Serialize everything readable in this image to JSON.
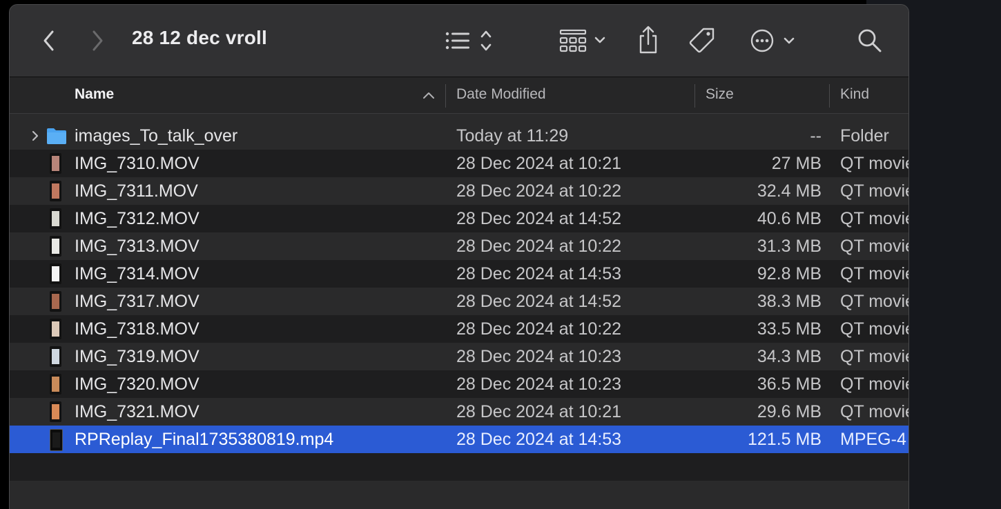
{
  "window": {
    "title": "28 12 dec vroll"
  },
  "toolbar": {
    "back_icon": "chevron-left-icon",
    "forward_icon": "chevron-right-icon",
    "list_view_icon": "list-view-icon",
    "group_icon": "group-grid-icon",
    "share_icon": "share-icon",
    "tag_icon": "tag-icon",
    "more_icon": "ellipsis-circle-icon",
    "search_icon": "search-icon"
  },
  "columns": {
    "name": "Name",
    "date": "Date Modified",
    "size": "Size",
    "kind": "Kind"
  },
  "files": [
    {
      "name": "images_To_talk_over",
      "date": "Today at 11:29",
      "size": "--",
      "kind": "Folder",
      "type": "folder",
      "thumb": "#4aa3f0"
    },
    {
      "name": "IMG_7310.MOV",
      "date": "28 Dec 2024 at 10:21",
      "size": "27 MB",
      "kind": "QT movie",
      "type": "video",
      "thumb": "#b8857a"
    },
    {
      "name": "IMG_7311.MOV",
      "date": "28 Dec 2024 at 10:22",
      "size": "32.4 MB",
      "kind": "QT movie",
      "type": "video",
      "thumb": "#c0785f"
    },
    {
      "name": "IMG_7312.MOV",
      "date": "28 Dec 2024 at 14:52",
      "size": "40.6 MB",
      "kind": "QT movie",
      "type": "video",
      "thumb": "#d9d9d2"
    },
    {
      "name": "IMG_7313.MOV",
      "date": "28 Dec 2024 at 10:22",
      "size": "31.3 MB",
      "kind": "QT movie",
      "type": "video",
      "thumb": "#e9e9e6"
    },
    {
      "name": "IMG_7314.MOV",
      "date": "28 Dec 2024 at 14:53",
      "size": "92.8 MB",
      "kind": "QT movie",
      "type": "video",
      "thumb": "#f4f4f4"
    },
    {
      "name": "IMG_7317.MOV",
      "date": "28 Dec 2024 at 14:52",
      "size": "38.3 MB",
      "kind": "QT movie",
      "type": "video",
      "thumb": "#a8684f"
    },
    {
      "name": "IMG_7318.MOV",
      "date": "28 Dec 2024 at 10:22",
      "size": "33.5 MB",
      "kind": "QT movie",
      "type": "video",
      "thumb": "#dcc9b8"
    },
    {
      "name": "IMG_7319.MOV",
      "date": "28 Dec 2024 at 10:23",
      "size": "34.3 MB",
      "kind": "QT movie",
      "type": "video",
      "thumb": "#cfd7e0"
    },
    {
      "name": "IMG_7320.MOV",
      "date": "28 Dec 2024 at 10:23",
      "size": "36.5 MB",
      "kind": "QT movie",
      "type": "video",
      "thumb": "#c98b5a"
    },
    {
      "name": "IMG_7321.MOV",
      "date": "28 Dec 2024 at 10:21",
      "size": "29.6 MB",
      "kind": "QT movie",
      "type": "video",
      "thumb": "#d98a57"
    },
    {
      "name": "RPReplay_Final1735380819.mp4",
      "date": "28 Dec 2024 at 14:53",
      "size": "121.5 MB",
      "kind": "MPEG-4",
      "type": "video",
      "thumb": "#0c0c0c",
      "selected": true
    }
  ],
  "colors": {
    "selection": "#2b5bd4",
    "folder": "#4aa3f0"
  }
}
